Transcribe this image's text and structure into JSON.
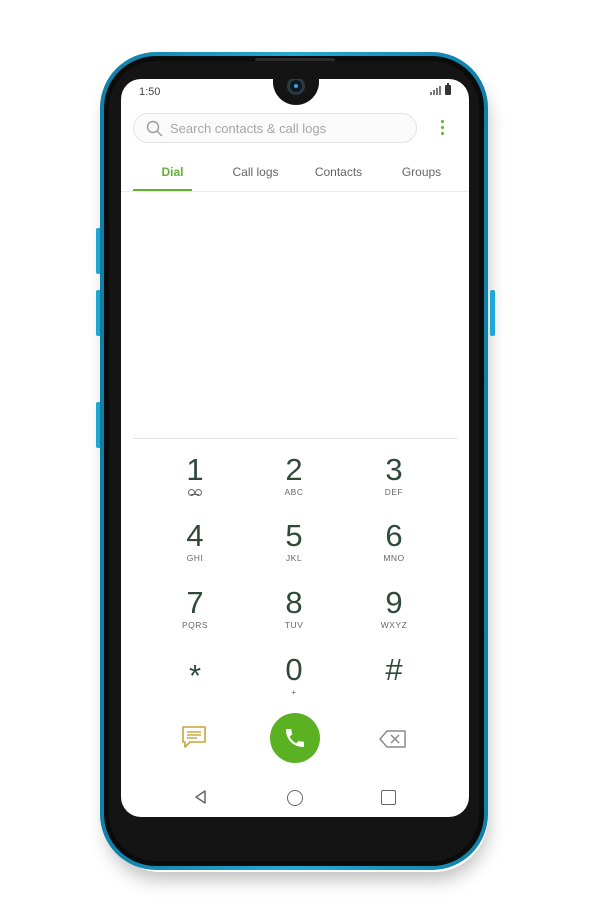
{
  "status_bar": {
    "time": "1:50"
  },
  "search": {
    "placeholder": "Search contacts & call logs"
  },
  "tabs": [
    {
      "label": "Dial",
      "active": true
    },
    {
      "label": "Call logs",
      "active": false
    },
    {
      "label": "Contacts",
      "active": false
    },
    {
      "label": "Groups",
      "active": false
    }
  ],
  "keypad": [
    {
      "digit": "1",
      "letters": "",
      "icon": "voicemail-icon"
    },
    {
      "digit": "2",
      "letters": "ABC"
    },
    {
      "digit": "3",
      "letters": "DEF"
    },
    {
      "digit": "4",
      "letters": "GHI"
    },
    {
      "digit": "5",
      "letters": "JKL"
    },
    {
      "digit": "6",
      "letters": "MNO"
    },
    {
      "digit": "7",
      "letters": "PQRS"
    },
    {
      "digit": "8",
      "letters": "TUV"
    },
    {
      "digit": "9",
      "letters": "WXYZ"
    },
    {
      "digit": "*",
      "letters": ""
    },
    {
      "digit": "0",
      "letters": "+"
    },
    {
      "digit": "#",
      "letters": ""
    }
  ],
  "actions": {
    "message_icon": "message-icon",
    "call_icon": "phone-icon",
    "delete_icon": "backspace-icon"
  },
  "colors": {
    "accent": "#5fb130",
    "call_button": "#5ab122",
    "phone_frame": "#1fa7d6",
    "digit": "#304a3a"
  }
}
